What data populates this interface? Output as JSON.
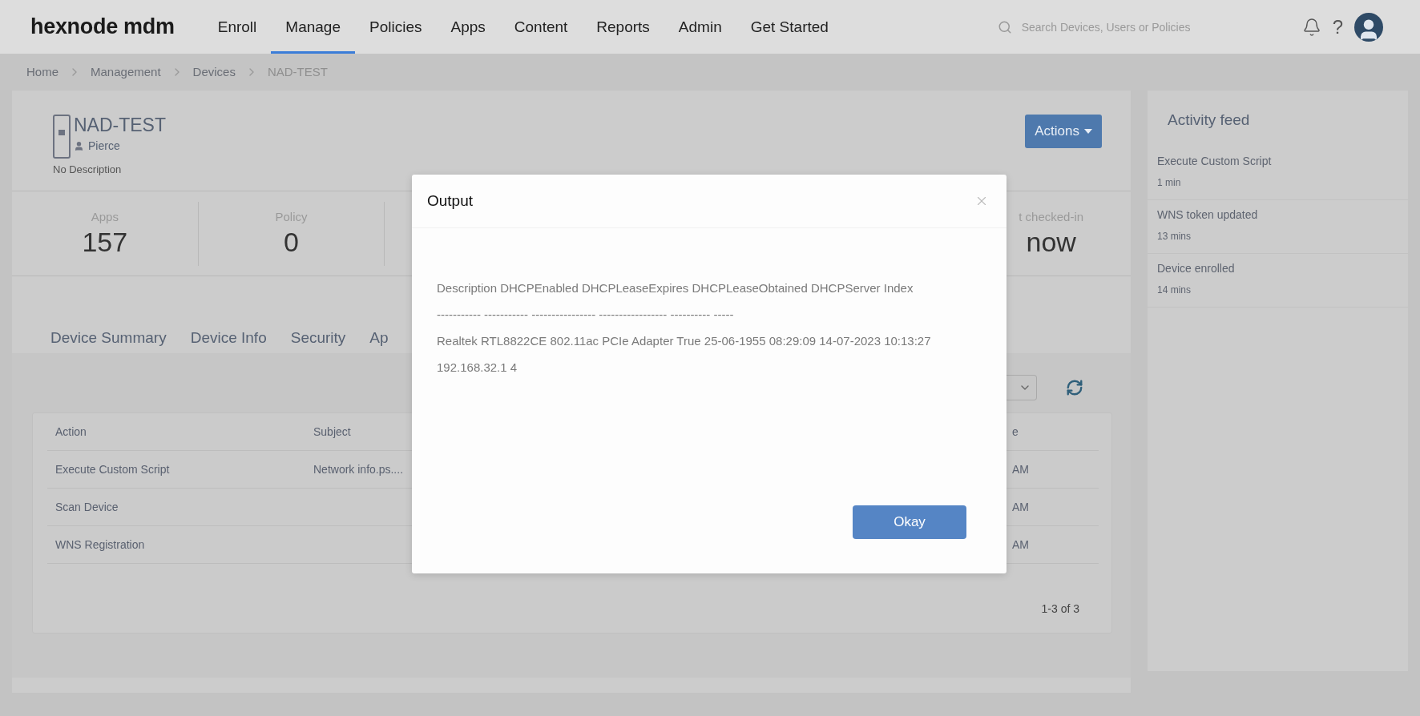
{
  "nav": {
    "logo": "hexnode mdm",
    "items": [
      {
        "label": "Enroll",
        "selected": false
      },
      {
        "label": "Manage",
        "selected": true
      },
      {
        "label": "Policies",
        "selected": false
      },
      {
        "label": "Apps",
        "selected": false
      },
      {
        "label": "Content",
        "selected": false
      },
      {
        "label": "Reports",
        "selected": false
      },
      {
        "label": "Admin",
        "selected": false
      },
      {
        "label": "Get Started",
        "selected": false
      }
    ],
    "search": {
      "placeholder": "Search Devices, Users or Policies"
    },
    "help": "?"
  },
  "breadcrumb": [
    "Home",
    "Management",
    "Devices",
    "NAD-TEST"
  ],
  "device": {
    "name": "NAD-TEST",
    "user": "Pierce",
    "description": "No Description",
    "actions_button": "Actions"
  },
  "stats": [
    {
      "label": "Apps",
      "value": "157"
    },
    {
      "label": "Policy",
      "value": "0"
    },
    {
      "label": "t checked-in",
      "value": "now"
    }
  ],
  "tabs": [
    "Device Summary",
    "Device Info",
    "Security",
    "Ap"
  ],
  "table": {
    "columns": [
      "Action",
      "Subject",
      "e"
    ],
    "rows": [
      {
        "cells": [
          "Execute Custom Script",
          "Network info.ps....",
          "AM"
        ]
      },
      {
        "cells": [
          "Scan Device",
          null,
          "AM"
        ]
      },
      {
        "cells": [
          "WNS Registration",
          null,
          "AM"
        ]
      }
    ],
    "pagination": "1-3 of 3"
  },
  "activity_feed": {
    "title": "Activity feed",
    "items": [
      {
        "title": "Execute Custom Script",
        "time": "1 min"
      },
      {
        "title": "WNS token updated",
        "time": "13 mins"
      },
      {
        "title": "Device enrolled",
        "time": "14 mins"
      }
    ]
  },
  "dialog": {
    "title": "Output",
    "lines": [
      "Description DHCPEnabled DHCPLeaseExpires DHCPLeaseObtained DHCPServer Index",
      "----------- ----------- ---------------- ----------------- ---------- -----",
      "Realtek RTL8822CE 802.11ac PCIe Adapter True 25-06-1955 08:29:09 14-07-2023 10:13:27 192.168.32.1 4"
    ],
    "ok_button": "Okay"
  }
}
